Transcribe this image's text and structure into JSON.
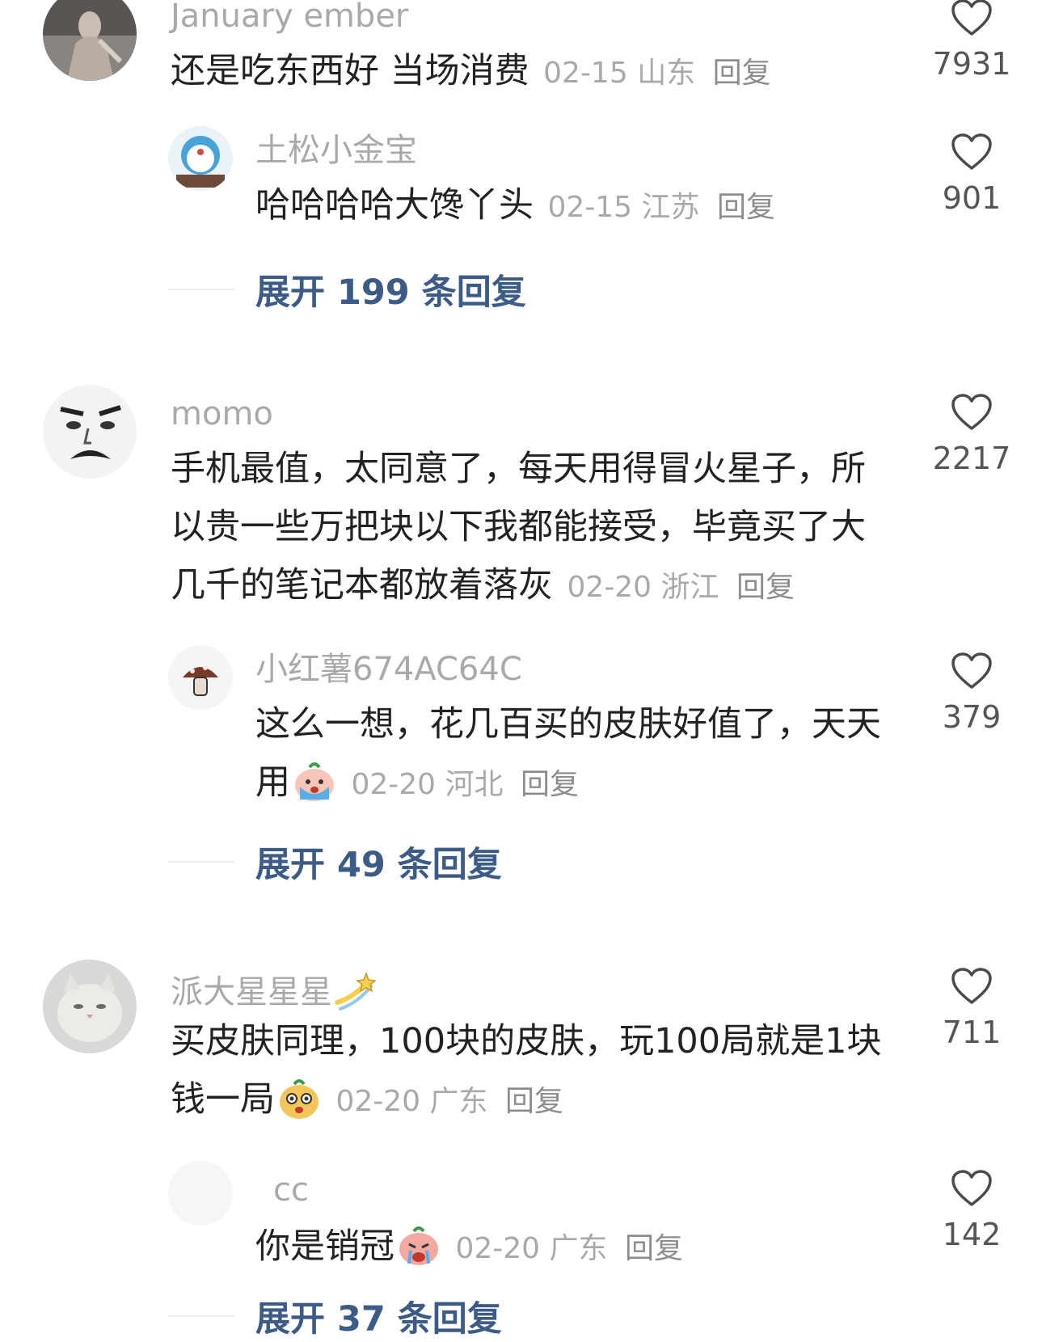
{
  "comments": [
    {
      "username": "January ember",
      "text": "还是吃东西好 当场消费",
      "date": "02-15",
      "location": "山东",
      "reply_label": "回复",
      "likes": "7931",
      "reply": {
        "username": "土松小金宝",
        "text": "哈哈哈哈大馋丫头",
        "date": "02-15",
        "location": "江苏",
        "reply_label": "回复",
        "likes": "901"
      },
      "expand_label": "展开 199 条回复"
    },
    {
      "username": "momo",
      "text": "手机最值，太同意了，每天用得冒火星子，所以贵一些万把块以下我都能接受，毕竟买了大几千的笔记本都放着落灰",
      "date": "02-20",
      "location": "浙江",
      "reply_label": "回复",
      "likes": "2217",
      "reply": {
        "username": "小红薯674AC64C",
        "text": "这么一想，花几百买的皮肤好值了，天天用",
        "emoji": "crying-emoji",
        "date": "02-20",
        "location": "河北",
        "reply_label": "回复",
        "likes": "379"
      },
      "expand_label": "展开 49 条回复"
    },
    {
      "username": "派大星星星",
      "username_emoji": "shooting-star-emoji",
      "text": "买皮肤同理，100块的皮肤，玩100局就是1块钱一局",
      "emoji": "shocked-emoji",
      "date": "02-20",
      "location": "广东",
      "reply_label": "回复",
      "likes": "711",
      "reply": {
        "username": "cc",
        "text": "你是销冠",
        "emoji": "crying-emoji",
        "date": "02-20",
        "location": "广东",
        "reply_label": "回复",
        "likes": "142"
      },
      "expand_label": "展开 37 条回复"
    }
  ],
  "colors": {
    "expand_link": "#3c5b86",
    "meta_gray": "#a9a9a9",
    "text": "#222222"
  }
}
